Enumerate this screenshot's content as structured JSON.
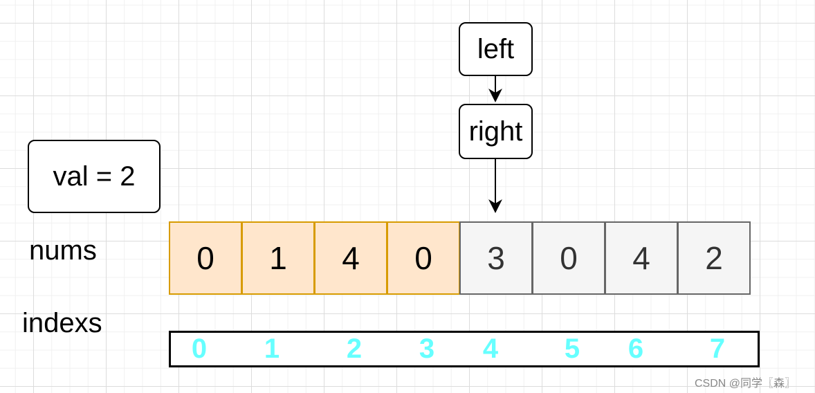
{
  "val_box": "val = 2",
  "left_label": "left",
  "right_label": "right",
  "nums_label": "nums",
  "indexs_label": "indexs",
  "nums": [
    "0",
    "1",
    "4",
    "0",
    "3",
    "0",
    "4",
    "2"
  ],
  "highlighted_count": 4,
  "indexes": [
    "0",
    "1",
    "2",
    "3",
    "4",
    "5",
    "6",
    "7"
  ],
  "watermark": "CSDN @同学〖森〗",
  "colors": {
    "highlight_fill": "#ffe6cc",
    "highlight_stroke": "#d79b00",
    "normal_fill": "#f5f5f5",
    "normal_stroke": "#666666",
    "index_text": "#66ffff"
  }
}
